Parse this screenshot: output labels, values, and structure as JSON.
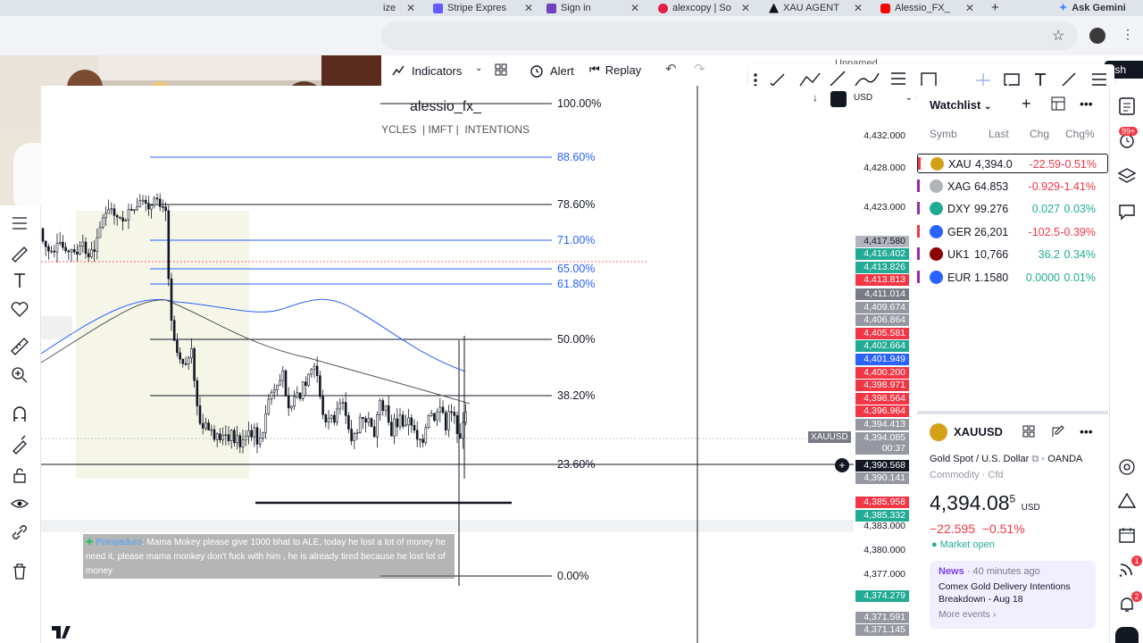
{
  "browser": {
    "tabs": [
      {
        "label": "ize",
        "icon": "tab-icon",
        "color": "#888888"
      },
      {
        "label": "Stripe Expres",
        "icon": "stripe-icon",
        "color": "#635bff"
      },
      {
        "label": "Sign in",
        "icon": "signin-icon",
        "color": "#6f42c1"
      },
      {
        "label": "alexcopy | So",
        "icon": "alexcopy-icon",
        "color": "#e11d48"
      },
      {
        "label": "XAU AGENT",
        "icon": "xau-agent-icon",
        "color": "#111111"
      },
      {
        "label": "Alessio_FX_",
        "icon": "youtube-icon",
        "color": "#ff0000"
      }
    ],
    "new_tab": "+",
    "ask_gemini": "Ask Gemini"
  },
  "toolbar": {
    "indicators": "Indicators",
    "alert": "Alert",
    "replay": "Replay",
    "unnamed": "Unnamed",
    "publish": "lish"
  },
  "chart": {
    "author": "alessio_fx_",
    "legend_text": "YCLES  | IMFT |  INTENTIONS",
    "crosshair_symbol": "XAUUSD",
    "fib_levels": [
      {
        "label": "100.00%",
        "color": "#131722"
      },
      {
        "label": "88.60%",
        "color": "#2962ff"
      },
      {
        "label": "78.60%",
        "color": "#131722"
      },
      {
        "label": "71.00%",
        "color": "#2962ff"
      },
      {
        "label": "65.00%",
        "color": "#2962ff"
      },
      {
        "label": "61.80%",
        "color": "#2962ff"
      },
      {
        "label": "50.00%",
        "color": "#131722"
      },
      {
        "label": "38.20%",
        "color": "#131722"
      },
      {
        "label": "23.60%",
        "color": "#131722"
      },
      {
        "label": "0.00%",
        "color": "#131722"
      }
    ],
    "currency": "USD",
    "price_ticks": [
      "4,432.000",
      "4,428.000",
      "4,423.000",
      "4,383.000",
      "4,380.000",
      "4,377.000"
    ],
    "price_tags": [
      {
        "label": "4,417.580",
        "color": "#b2b5be",
        "text": "#131722"
      },
      {
        "label": "4,416.402",
        "color": "#22ab94",
        "text": "#ffffff"
      },
      {
        "label": "4,413.826",
        "color": "#22ab94",
        "text": "#ffffff"
      },
      {
        "label": "4,413.813",
        "color": "#f23645",
        "text": "#ffffff"
      },
      {
        "label": "4,411.014",
        "color": "#787b86",
        "text": "#ffffff"
      },
      {
        "label": "4,409.674",
        "color": "#9598a1",
        "text": "#ffffff"
      },
      {
        "label": "4,406.864",
        "color": "#9598a1",
        "text": "#ffffff"
      },
      {
        "label": "4,405.581",
        "color": "#f23645",
        "text": "#ffffff"
      },
      {
        "label": "4,402.664",
        "color": "#22ab94",
        "text": "#ffffff"
      },
      {
        "label": "4,401.949",
        "color": "#2962ff",
        "text": "#ffffff"
      },
      {
        "label": "4,400.200",
        "color": "#f23645",
        "text": "#ffffff"
      },
      {
        "label": "4,398.971",
        "color": "#f23645",
        "text": "#ffffff"
      },
      {
        "label": "4,398.564",
        "color": "#f23645",
        "text": "#ffffff"
      },
      {
        "label": "4,396.964",
        "color": "#f23645",
        "text": "#ffffff"
      },
      {
        "label": "4,394.413",
        "color": "#9598a1",
        "text": "#ffffff"
      },
      {
        "label": "4,394.085",
        "color": "#9598a1",
        "text": "#ffffff"
      },
      {
        "label": "00:37",
        "color": "#9598a1",
        "text": "#ffffff"
      },
      {
        "label": "4,390.568",
        "color": "#131722",
        "text": "#ffffff"
      },
      {
        "label": "4,390.141",
        "color": "#9598a1",
        "text": "#ffffff"
      },
      {
        "label": "4,385.958",
        "color": "#f23645",
        "text": "#ffffff"
      },
      {
        "label": "4,385.332",
        "color": "#22ab94",
        "text": "#ffffff"
      },
      {
        "label": "4,374.279",
        "color": "#22ab94",
        "text": "#ffffff"
      },
      {
        "label": "4,371.591",
        "color": "#9598a1",
        "text": "#ffffff"
      },
      {
        "label": "4,371.145",
        "color": "#9598a1",
        "text": "#ffffff"
      }
    ]
  },
  "chat": {
    "user": "Pompaduro",
    "message": ": Mama Mokey please give 1000 bhat to ALE, today he lost a lot of money he need it, please mama monkey don't fuck with him , he is already tired because he lost lot of money"
  },
  "watchlist": {
    "title": "Watchlist",
    "columns": [
      "Symb",
      "Last",
      "Chg",
      "Chg%"
    ],
    "rows": [
      {
        "symbol": "XAU",
        "last": "4,394.0",
        "chg": "-22.59",
        "chgp": "-0.51%",
        "dir": "down",
        "icon_color": "#d4a017",
        "flag": "#f23645"
      },
      {
        "symbol": "XAG",
        "last": "64.853",
        "chg": "-0.929",
        "chgp": "-1.41%",
        "dir": "down",
        "icon_color": "#b0b3b8",
        "flag": "#9c27b0"
      },
      {
        "symbol": "DXY",
        "last": "99.276",
        "chg": "0.027",
        "chgp": "0.03%",
        "dir": "up",
        "icon_color": "#22ab94",
        "flag": "#9c27b0"
      },
      {
        "symbol": "GER",
        "last": "26,201",
        "chg": "-102.5",
        "chgp": "-0.39%",
        "dir": "down",
        "icon_color": "#2962ff",
        "flag": "#f23645"
      },
      {
        "symbol": "UK1",
        "last": "10,766",
        "chg": "36.2",
        "chgp": "0.34%",
        "dir": "up",
        "icon_color": "#8b0000",
        "flag": "#9c27b0"
      },
      {
        "symbol": "EUR",
        "last": "1.1580",
        "chg": "0.0000",
        "chgp": "0.01%",
        "dir": "up",
        "icon_color": "#2962ff",
        "flag": "#9c27b0"
      }
    ]
  },
  "detail": {
    "symbol": "XAUUSD",
    "name": "Gold Spot / U.S. Dollar",
    "broker": "OANDA",
    "category": "Commodity",
    "type": "Cfd",
    "price_main": "4,394.08",
    "price_sup": "5",
    "currency": "USD",
    "change": "−22.595",
    "change_pct": "−0.51%",
    "market_status": "Market open",
    "news_label": "News",
    "news_time": "40 minutes ago",
    "news_title": "Comex Gold Delivery Intentions Breakdown - Aug 18",
    "more_events": "More events"
  },
  "sidebar_badges": {
    "notifications": "99+",
    "ideas": "1",
    "alerts": "2"
  },
  "colors": {
    "up": "#22ab94",
    "down": "#f23645",
    "accent": "#2962ff"
  }
}
